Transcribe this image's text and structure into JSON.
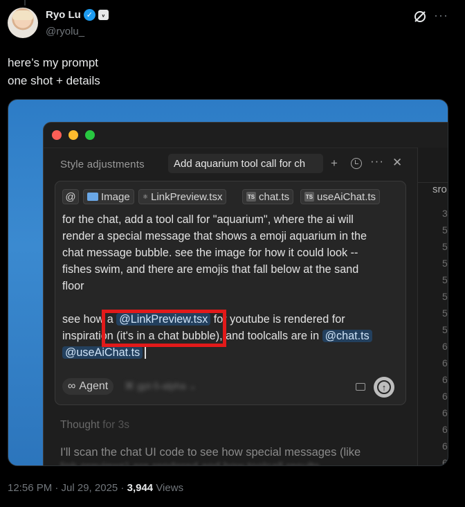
{
  "author": {
    "name": "Ryo Lu",
    "handle": "@ryolu_"
  },
  "tweet": {
    "line1": "here’s my prompt",
    "line2": "one shot + details"
  },
  "editor": {
    "tab_inactive": "Style adjustments",
    "tab_active": "Add aquarium tool call for ch",
    "side_label": "sro",
    "side_numbers": [
      "3",
      "5",
      "5",
      "5",
      "5",
      "5",
      "5",
      "5",
      "6",
      "6",
      "6",
      "6",
      "6",
      "6",
      "6",
      "6"
    ],
    "chips": [
      "@",
      "Image",
      "LinkPreview.tsx",
      "chat.ts",
      "useAiChat.ts"
    ],
    "ts_badge": "TS",
    "prompt_lines": [
      "for the chat, add a tool call for \"aquarium\", where the ai will",
      "render a special message that shows a emoji aquarium in the",
      "chat message bubble. see the image for how it could look --",
      "fishes swim, and there are emojis that fall below at the sand",
      "floor"
    ],
    "prompt2_pre": "see how a",
    "prompt2_mention1": "@LinkPreview.tsx",
    "prompt2_post": "for youtube is rendered for",
    "prompt3_pre": "inspiration (it's in a chat bubble), and toolcalls are in",
    "prompt3_mention2": "@chat.ts",
    "prompt4_mention3": "@useAiChat.ts",
    "agent_symbol": "∞",
    "agent_label": "Agent",
    "model_label": "⌘ gpt-5-alpha ⌄",
    "thought_label": "Thought",
    "thought_duration": "for 3s",
    "response_line1": "I'll scan the chat UI code to see how special messages (like",
    "response_line2": "link previews) are rendered and how toolcall results..."
  },
  "meta": {
    "time": "12:56 PM · Jul 29, 2025 · ",
    "views_count": "3,944",
    "views_label": " Views"
  },
  "colors": {
    "verified": "#1d9bf0",
    "highlight_box": "#e21a1a",
    "media_bg": "#2d7cc6"
  }
}
